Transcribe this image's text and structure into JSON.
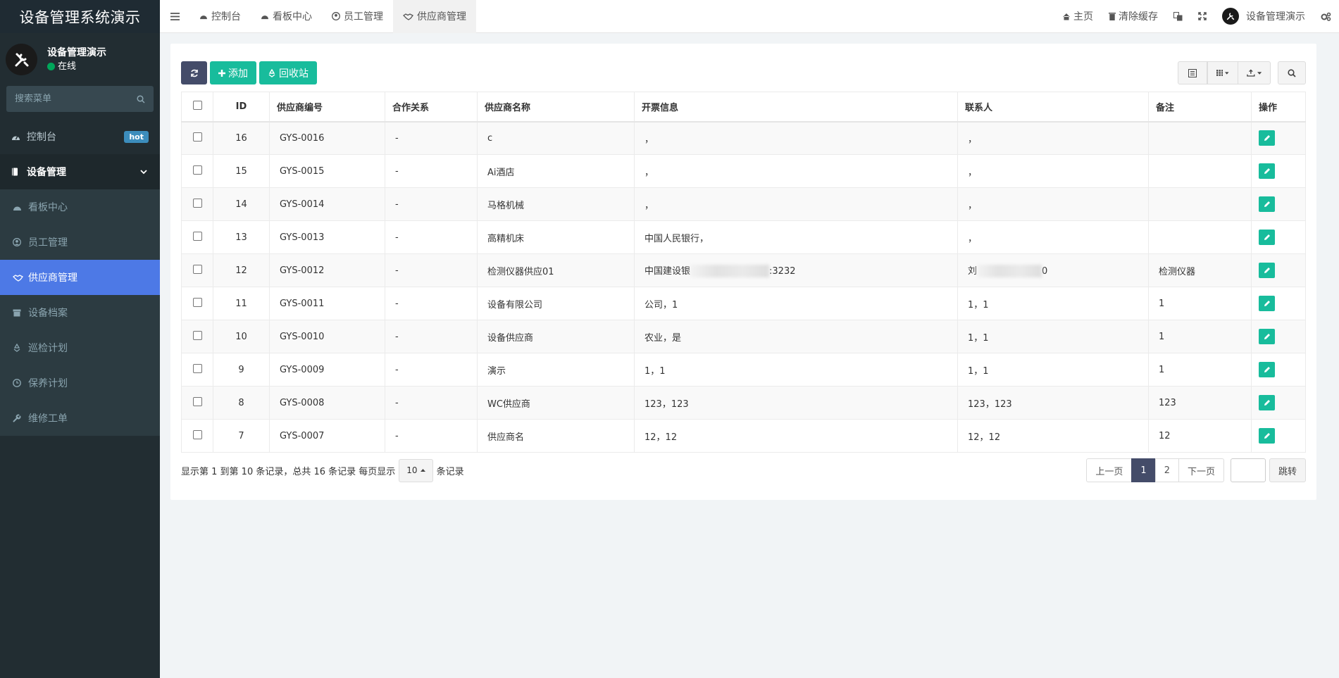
{
  "app": {
    "title": "设备管理系统演示"
  },
  "user": {
    "name": "设备管理演示",
    "status": "在线"
  },
  "sidebar": {
    "search_placeholder": "搜索菜单",
    "dashboard": {
      "label": "控制台",
      "badge": "hot"
    },
    "group": {
      "label": "设备管理"
    },
    "items": [
      {
        "label": "看板中心",
        "icon": "dashboard-icon"
      },
      {
        "label": "员工管理",
        "icon": "user-circle-icon"
      },
      {
        "label": "供应商管理",
        "icon": "handshake-icon",
        "active": true
      },
      {
        "label": "设备档案",
        "icon": "archive-icon"
      },
      {
        "label": "巡检计划",
        "icon": "recycle-icon"
      },
      {
        "label": "保养计划",
        "icon": "clock-icon"
      },
      {
        "label": "维修工单",
        "icon": "wrench-icon"
      }
    ]
  },
  "topnav": {
    "tabs": [
      "控制台",
      "看板中心",
      "员工管理",
      "供应商管理"
    ],
    "home": "主页",
    "clear_cache": "清除缓存",
    "username": "设备管理演示"
  },
  "toolbar": {
    "add": "添加",
    "recycle": "回收站"
  },
  "table": {
    "headers": [
      "ID",
      "供应商编号",
      "合作关系",
      "供应商名称",
      "开票信息",
      "联系人",
      "备注",
      "操作"
    ],
    "rows": [
      {
        "id": "16",
        "code": "GYS-0016",
        "relation": "-",
        "name": "c",
        "invoice": "，",
        "contact": "，",
        "remark": ""
      },
      {
        "id": "15",
        "code": "GYS-0015",
        "relation": "-",
        "name": "Ai酒店",
        "invoice": "，",
        "contact": "，",
        "remark": ""
      },
      {
        "id": "14",
        "code": "GYS-0014",
        "relation": "-",
        "name": "马格机械",
        "invoice": "，",
        "contact": "，",
        "remark": ""
      },
      {
        "id": "13",
        "code": "GYS-0013",
        "relation": "-",
        "name": "高精机床",
        "invoice": "中国人民银行，",
        "contact": "，",
        "remark": ""
      },
      {
        "id": "12",
        "code": "GYS-0012",
        "relation": "-",
        "name": "检测仪器供应01",
        "invoice_pre": "中国建设银",
        "invoice_post": ":3232",
        "contact_pre": "刘",
        "contact_post": "0",
        "remark": "检测仪器"
      },
      {
        "id": "11",
        "code": "GYS-0011",
        "relation": "-",
        "name": "设备有限公司",
        "invoice": "公司，1",
        "contact": "1，1",
        "remark": "1"
      },
      {
        "id": "10",
        "code": "GYS-0010",
        "relation": "-",
        "name": "设备供应商",
        "invoice": "农业，是",
        "contact": "1，1",
        "remark": "1"
      },
      {
        "id": "9",
        "code": "GYS-0009",
        "relation": "-",
        "name": "演示",
        "invoice": "1，1",
        "contact": "1，1",
        "remark": "1"
      },
      {
        "id": "8",
        "code": "GYS-0008",
        "relation": "-",
        "name": "WC供应商",
        "invoice": "123，123",
        "contact": "123，123",
        "remark": "123"
      },
      {
        "id": "7",
        "code": "GYS-0007",
        "relation": "-",
        "name": "供应商名",
        "invoice": "12，12",
        "contact": "12，12",
        "remark": "12"
      }
    ]
  },
  "footer": {
    "summary": "显示第 1 到第 10 条记录，总共 16 条记录 每页显示",
    "page_size": "10",
    "suffix": "条记录",
    "prev": "上一页",
    "pages": [
      "1",
      "2"
    ],
    "next": "下一页",
    "jump": "跳转"
  },
  "colors": {
    "sidebar_bg": "#222d32",
    "active_menu": "#4d79e6",
    "green": "#18bc9c",
    "dark_button": "#444c69"
  }
}
